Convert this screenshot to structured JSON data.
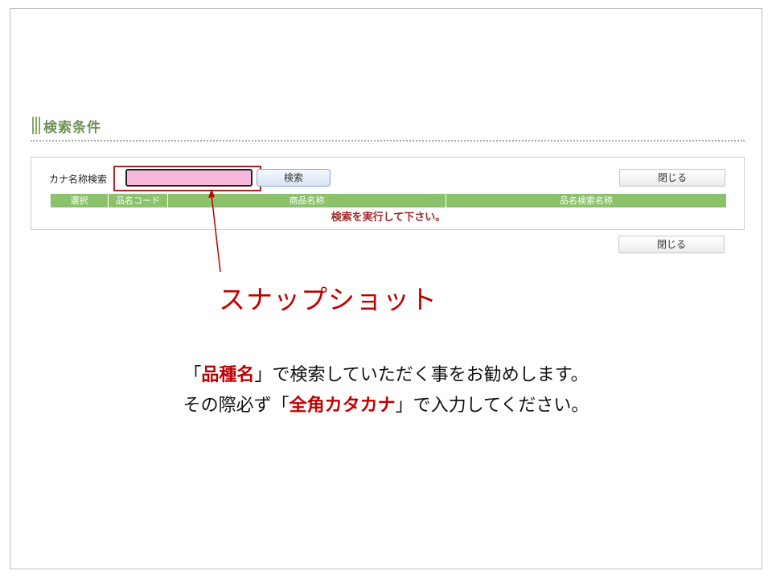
{
  "section": {
    "title": "検索条件"
  },
  "search": {
    "label": "カナ名称検索",
    "input_value": "",
    "input_placeholder": "",
    "search_button": "検索",
    "close_button_top": "閉じる",
    "close_button_bottom": "閉じる"
  },
  "results": {
    "columns": [
      "選択",
      "品名コード",
      "商品名称",
      "品名検索名称"
    ],
    "message": "検索を実行して下さい。"
  },
  "annotation": {
    "label": "スナップショット"
  },
  "instructions": {
    "line1_pre": "「",
    "line1_em": "品種名",
    "line1_post": "」で検索していただく事をお勧めします。",
    "line2_pre": "その際必ず「",
    "line2_em": "全角カタカナ",
    "line2_post": "」で入力してください。"
  },
  "colors": {
    "header_green": "#8cc26b",
    "title_green": "#6b8f55",
    "accent_red": "#c00000",
    "input_pink": "#f7b8dc"
  }
}
